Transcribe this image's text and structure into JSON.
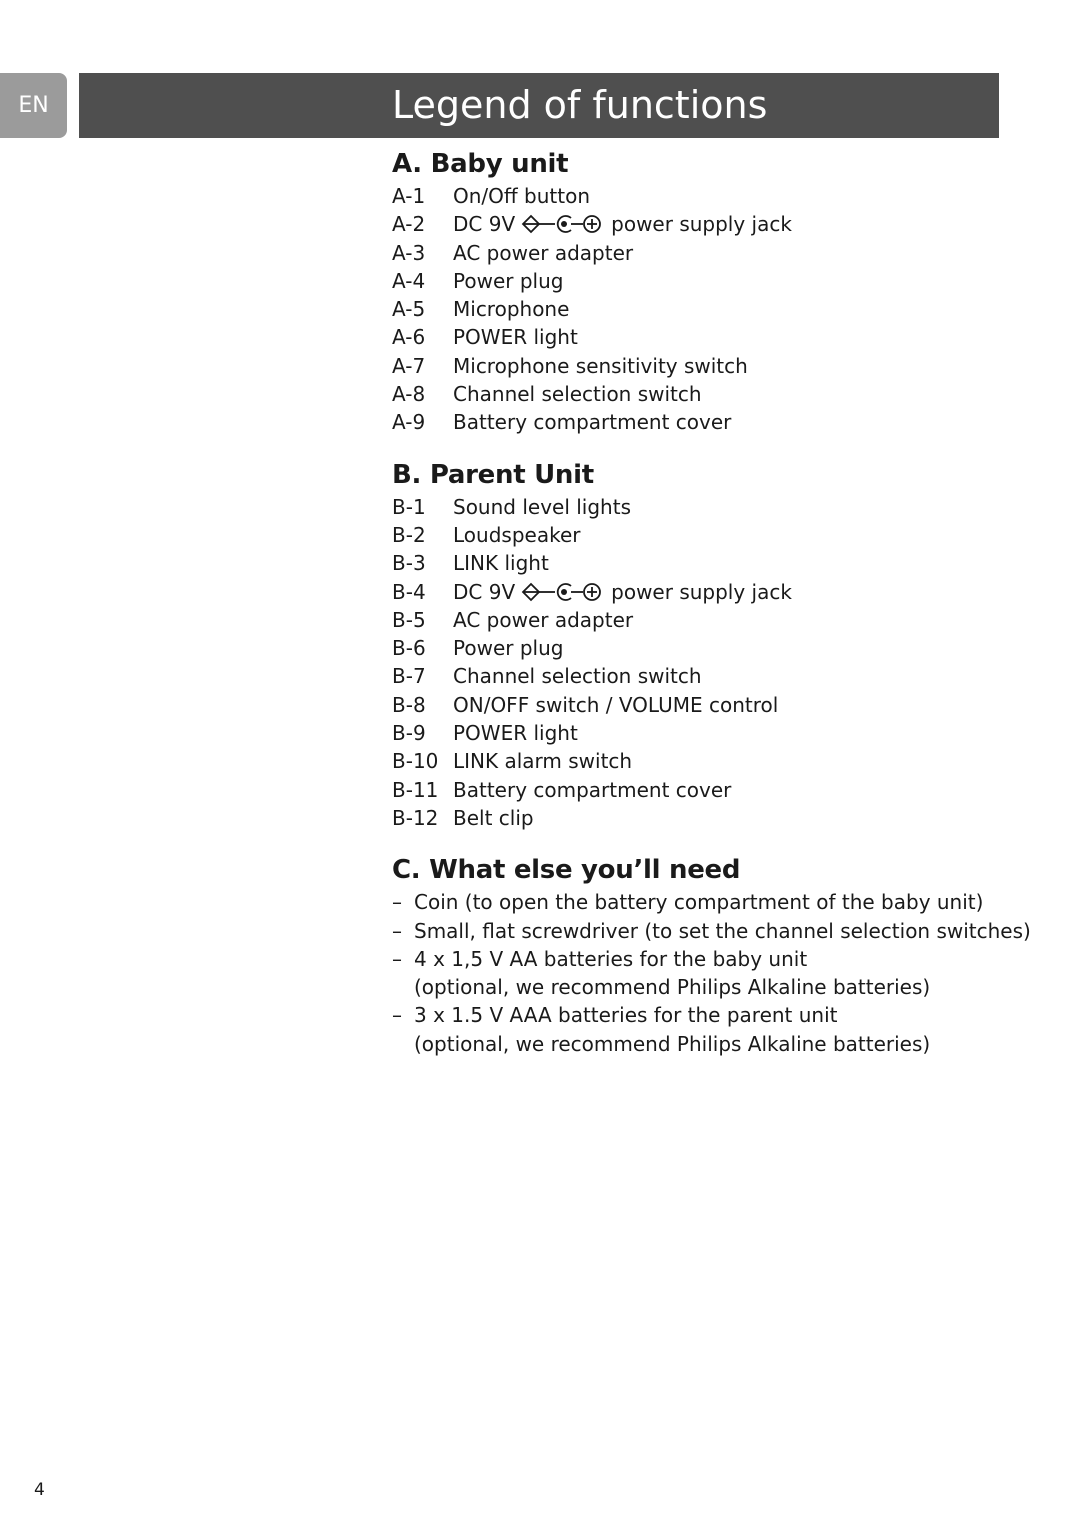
{
  "header": {
    "language_tab": "EN",
    "title": "Legend of functions"
  },
  "sections": {
    "baby_unit": {
      "heading": "A. Baby unit",
      "items": [
        {
          "code": "A-1",
          "label": "On/Off button"
        },
        {
          "code": "A-2",
          "label_before": "DC 9V",
          "icon": "dc-polarity-symbol-icon",
          "label_after": "power supply jack"
        },
        {
          "code": "A-3",
          "label": "AC power adapter"
        },
        {
          "code": "A-4",
          "label": "Power plug"
        },
        {
          "code": "A-5",
          "label": "Microphone"
        },
        {
          "code": "A-6",
          "label": "POWER light"
        },
        {
          "code": "A-7",
          "label": "Microphone sensitivity switch"
        },
        {
          "code": "A-8",
          "label": "Channel selection switch"
        },
        {
          "code": "A-9",
          "label": "Battery compartment cover"
        }
      ]
    },
    "parent_unit": {
      "heading": "B. Parent Unit",
      "items": [
        {
          "code": "B-1",
          "label": "Sound level lights"
        },
        {
          "code": "B-2",
          "label": "Loudspeaker"
        },
        {
          "code": "B-3",
          "label": "LINK light"
        },
        {
          "code": "B-4",
          "label_before": "DC 9V",
          "icon": "dc-polarity-symbol-icon",
          "label_after": "power supply jack"
        },
        {
          "code": "B-5",
          "label": "AC power adapter"
        },
        {
          "code": "B-6",
          "label": "Power plug"
        },
        {
          "code": "B-7",
          "label": "Channel selection switch"
        },
        {
          "code": "B-8",
          "label": "ON/OFF switch / VOLUME control"
        },
        {
          "code": "B-9",
          "label": "POWER light"
        },
        {
          "code": "B-10",
          "label": "LINK alarm switch"
        },
        {
          "code": "B-11",
          "label": "Battery compartment cover"
        },
        {
          "code": "B-12",
          "label": "Belt clip"
        }
      ]
    },
    "what_else": {
      "heading": "C. What else you’ll need",
      "dash": "–",
      "items": [
        {
          "text": "Coin (to open the battery compartment of the baby unit)"
        },
        {
          "text": "Small, flat screwdriver (to set the channel selection switches)"
        },
        {
          "text": "4 x 1,5 V AA batteries for the baby unit",
          "note": "(optional, we recommend Philips Alkaline batteries)"
        },
        {
          "text": "3 x 1.5 V AAA batteries for the parent unit",
          "note": "(optional, we recommend Philips Alkaline batteries)"
        }
      ]
    }
  },
  "footer": {
    "page_number": "4"
  },
  "colors": {
    "title_bar": "#4f4f4f",
    "language_tab": "#9b9b9b",
    "text": "#1a1a1a"
  }
}
